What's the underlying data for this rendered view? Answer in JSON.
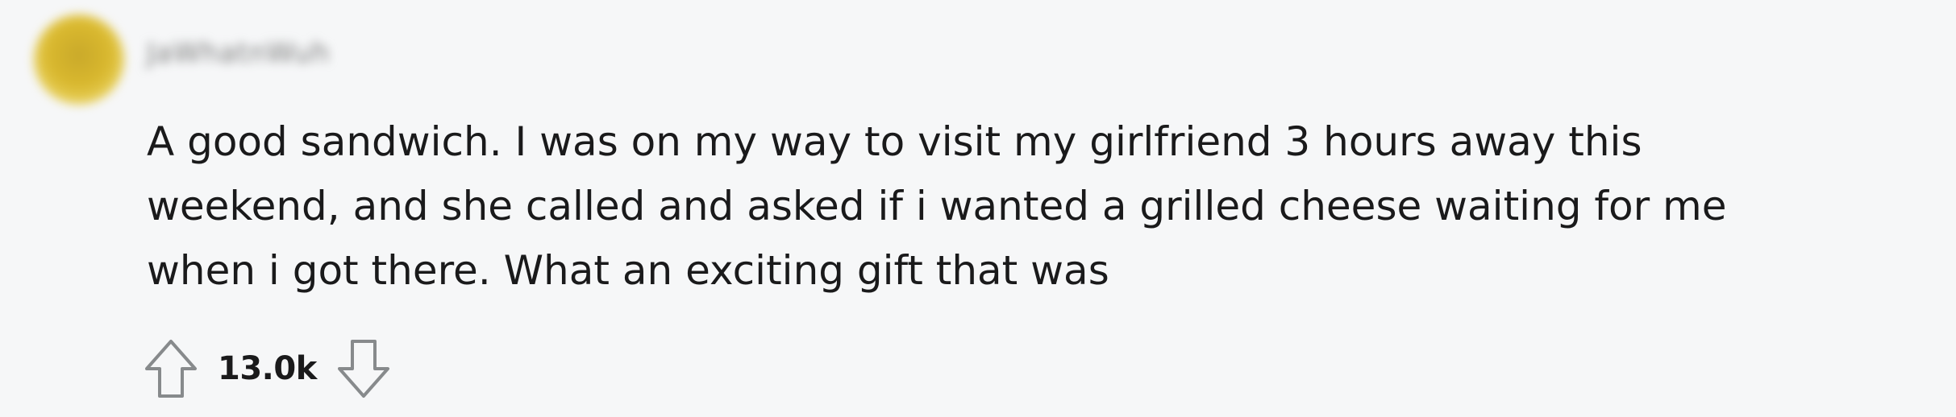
{
  "comment": {
    "author": "JaWhatnWuh",
    "body_lines": [
      "A good sandwich. I was on my way to visit my girlfriend 3 hours away this",
      "weekend, and she called and asked if i wanted a grilled cheese waiting for me",
      "when i got there. What an exciting gift that was"
    ],
    "score": "13.0k",
    "colors": {
      "avatar": "#d4b22c",
      "text": "#1a1a1b",
      "icon_stroke": "#878a8c",
      "background": "#f6f7f8"
    },
    "icons": {
      "upvote": "upvote-arrow-icon",
      "downvote": "downvote-arrow-icon"
    }
  }
}
